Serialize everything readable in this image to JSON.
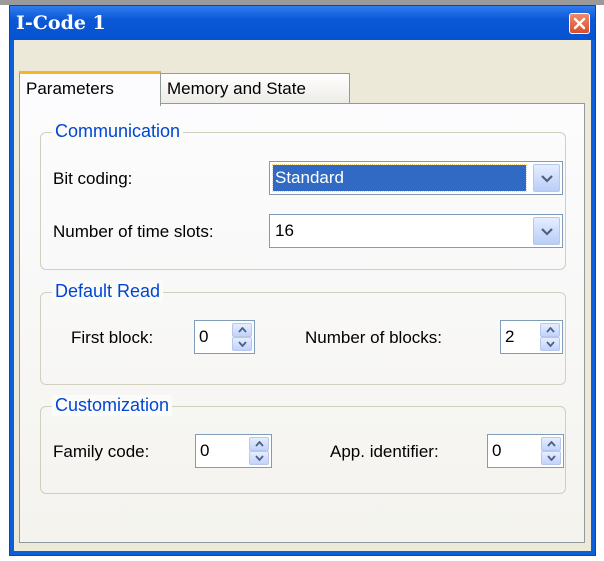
{
  "window": {
    "title": "I-Code 1"
  },
  "tabs": [
    {
      "label": "Parameters"
    },
    {
      "label": "Memory and State"
    }
  ],
  "communication": {
    "legend": "Communication",
    "bit_coding_label": "Bit coding:",
    "bit_coding_value": "Standard",
    "time_slots_label": "Number of time slots:",
    "time_slots_value": "16"
  },
  "default_read": {
    "legend": "Default Read",
    "first_block_label": "First block:",
    "first_block_value": "0",
    "num_blocks_label": "Number of blocks:",
    "num_blocks_value": "2"
  },
  "customization": {
    "legend": "Customization",
    "family_code_label": "Family code:",
    "family_code_value": "0",
    "app_id_label": "App. identifier:",
    "app_id_value": "0"
  },
  "colors": {
    "title_bar": "#0a58d6",
    "accent_text": "#0046d5",
    "selection": "#316ac5",
    "face": "#ece9d8"
  },
  "icons": {
    "close": "close-icon",
    "dropdown": "chevron-down-icon",
    "spin_up": "spin-up-icon",
    "spin_down": "spin-down-icon"
  }
}
